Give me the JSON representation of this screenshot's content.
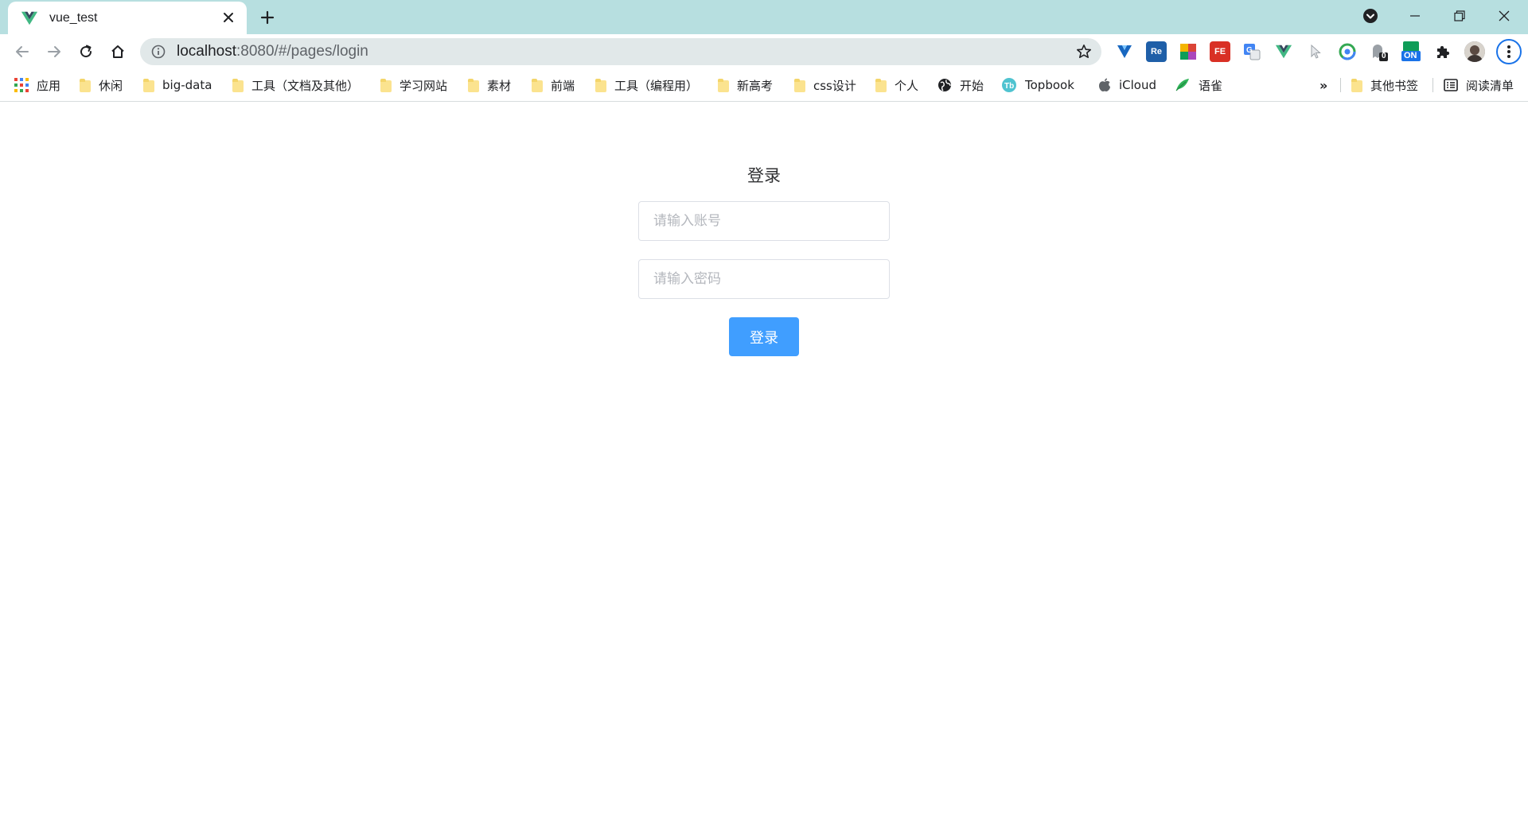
{
  "browser": {
    "tab_title": "vue_test",
    "url_host": "localhost",
    "url_path": ":8080/#/pages/login",
    "extension_labels": {
      "re": "Re",
      "fe": "FE",
      "badge_count": "0",
      "on": "ON"
    }
  },
  "bookmarks": {
    "items": [
      {
        "label": "应用",
        "icon": "apps-grid-icon"
      },
      {
        "label": "休闲",
        "icon": "folder-icon"
      },
      {
        "label": "big-data",
        "icon": "folder-icon"
      },
      {
        "label": "工具（文档及其他）",
        "icon": "folder-icon"
      },
      {
        "label": "学习网站",
        "icon": "folder-icon"
      },
      {
        "label": "素材",
        "icon": "folder-icon"
      },
      {
        "label": "前端",
        "icon": "folder-icon"
      },
      {
        "label": "工具（编程用）",
        "icon": "folder-icon"
      },
      {
        "label": "新高考",
        "icon": "folder-icon"
      },
      {
        "label": "css设计",
        "icon": "folder-icon"
      },
      {
        "label": "个人",
        "icon": "folder-icon"
      },
      {
        "label": "开始",
        "icon": "globe-icon"
      },
      {
        "label": "Topbook",
        "icon": "topbook-icon"
      },
      {
        "label": "iCloud",
        "icon": "apple-icon"
      },
      {
        "label": "语雀",
        "icon": "yuque-icon"
      }
    ],
    "overflow": "»",
    "other_bookmarks": "其他书签",
    "reading_list": "阅读清单"
  },
  "login": {
    "title": "登录",
    "account_placeholder": "请输入账号",
    "password_placeholder": "请输入密码",
    "submit_label": "登录",
    "accent_color": "#409eff"
  }
}
